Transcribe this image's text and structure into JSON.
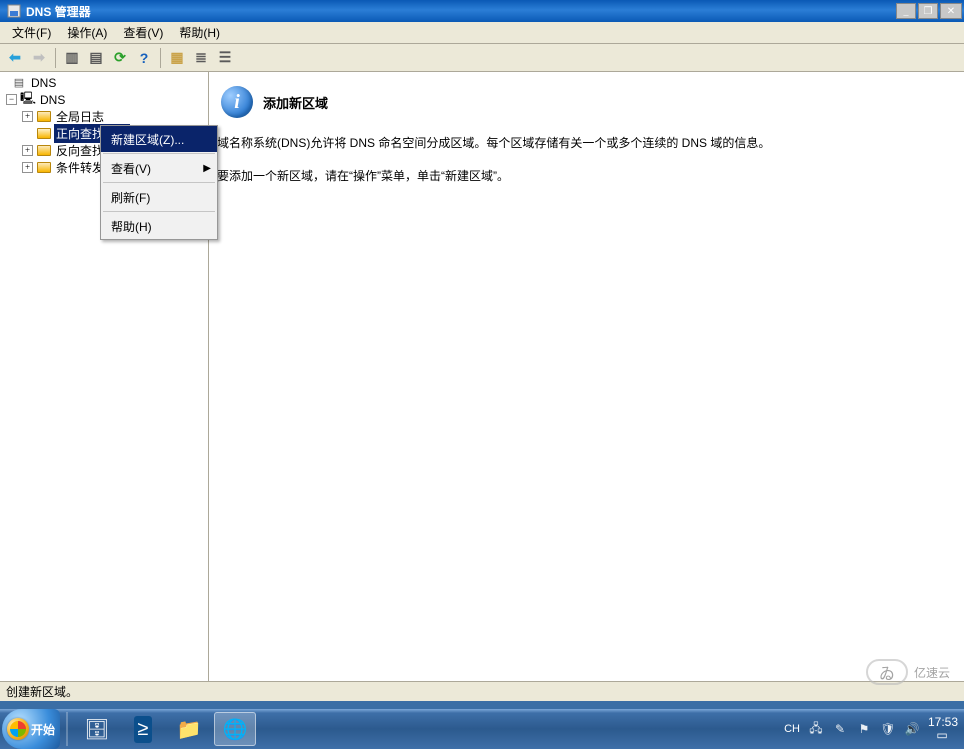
{
  "window": {
    "title": "DNS 管理器",
    "buttons": {
      "min": "_",
      "restore": "❐",
      "close": "✕"
    }
  },
  "menu": {
    "items": [
      "文件(F)",
      "操作(A)",
      "查看(V)",
      "帮助(H)"
    ]
  },
  "toolbar": {
    "items": [
      {
        "name": "back-icon",
        "glyph": "⬅",
        "color": "#27a0da",
        "enabled": true
      },
      {
        "name": "forward-icon",
        "glyph": "➡",
        "color": "#bfbfbf",
        "enabled": false
      },
      {
        "sep": true
      },
      {
        "name": "up-icon",
        "glyph": "▥",
        "color": "#5a5a5a",
        "enabled": true
      },
      {
        "name": "properties-icon",
        "glyph": "▤",
        "color": "#5a5a5a",
        "enabled": true
      },
      {
        "name": "crefresh-icon",
        "glyph": "⟳",
        "color": "#2aa02a",
        "enabled": true
      },
      {
        "name": "help-icon",
        "glyph": "?",
        "color": "#1560bd",
        "enabled": true
      },
      {
        "sep": true
      },
      {
        "name": "filter-icon",
        "glyph": "▦",
        "color": "#caa34a",
        "enabled": true
      },
      {
        "name": "list-icon",
        "glyph": "≣",
        "color": "#5a5a5a",
        "enabled": true
      },
      {
        "name": "detail-icon",
        "glyph": "☰",
        "color": "#5a5a5a",
        "enabled": true
      }
    ]
  },
  "tree": {
    "root": "DNS",
    "server": "DNS",
    "nodes": [
      {
        "label": "全局日志",
        "expandable": true,
        "selected": false
      },
      {
        "label": "正向查找区域",
        "expandable": false,
        "selected": true
      },
      {
        "label": "反向查找区域",
        "expandable": true,
        "selected": false
      },
      {
        "label": "条件转发器",
        "expandable": true,
        "selected": false
      }
    ]
  },
  "context_menu": {
    "items": [
      {
        "label": "新建区域(Z)...",
        "highlight": true
      },
      {
        "sep": true
      },
      {
        "label": "查看(V)",
        "submenu": true
      },
      {
        "sep": true
      },
      {
        "label": "刷新(F)"
      },
      {
        "sep": true
      },
      {
        "label": "帮助(H)"
      }
    ]
  },
  "content": {
    "title": "添加新区域",
    "p1": "域名称系统(DNS)允许将 DNS 命名空间分成区域。每个区域存储有关一个或多个连续的 DNS 域的信息。",
    "p2": "要添加一个新区域，请在“操作”菜单，单击“新建区域”。"
  },
  "statusbar": {
    "text": "创建新区域。"
  },
  "taskbar": {
    "start": "开始",
    "apps": [
      {
        "name": "server-manager-icon",
        "glyph": "🗄",
        "active": false
      },
      {
        "name": "powershell-icon",
        "glyph": "≥",
        "active": false,
        "bg": "#0b4f8c"
      },
      {
        "name": "explorer-icon",
        "glyph": "📁",
        "active": false
      },
      {
        "name": "dns-manager-icon",
        "glyph": "🌐",
        "active": true
      }
    ]
  },
  "tray": {
    "lang": "CH",
    "icons": [
      "network-icon",
      "feedback-icon",
      "perf-icon",
      "shield-icon",
      "speaker-icon"
    ],
    "time": "17:53",
    "date_glyph": "▭"
  },
  "watermark": {
    "glyph": "ゐ",
    "text": "亿速云"
  }
}
